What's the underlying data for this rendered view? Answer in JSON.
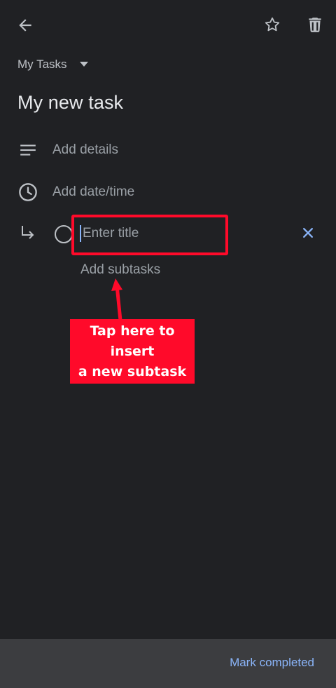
{
  "toolbar": {
    "back_icon": "arrow-back-icon",
    "star_icon": "star-outline-icon",
    "delete_icon": "trash-icon"
  },
  "task": {
    "list_name": "My Tasks",
    "title": "My new task",
    "details_placeholder": "Add details",
    "datetime_placeholder": "Add date/time",
    "subtask_title_placeholder": "Enter title",
    "add_subtasks_label": "Add subtasks"
  },
  "annotation": {
    "text": "Tap here to\ninsert\na new subtask",
    "color": "#ff0a2a"
  },
  "footer": {
    "mark_completed_label": "Mark completed"
  },
  "colors": {
    "background": "#202124",
    "accent": "#8ab4f8",
    "bottom_bar": "#3c3d40"
  }
}
